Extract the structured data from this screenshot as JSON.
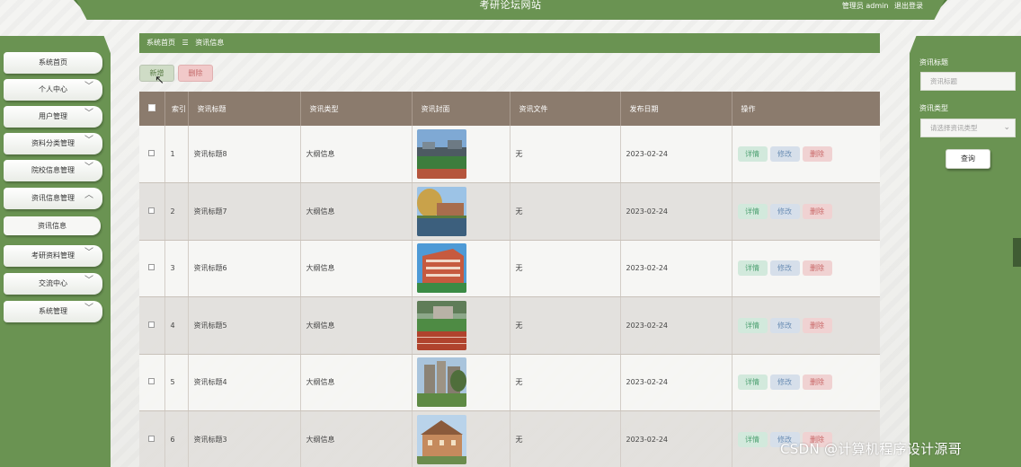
{
  "site": {
    "title": "考研论坛网站",
    "user_label": "管理员 admin",
    "logout_label": "退出登录"
  },
  "sidebar": {
    "items": [
      {
        "label": "系统首页",
        "chevron": ""
      },
      {
        "label": "个人中心",
        "chevron": "﹀"
      },
      {
        "label": "用户管理",
        "chevron": "﹀"
      },
      {
        "label": "资料分类管理",
        "chevron": "﹀"
      },
      {
        "label": "院校信息管理",
        "chevron": "﹀"
      },
      {
        "label": "资讯信息管理",
        "chevron": "︿"
      },
      {
        "label": "资讯信息",
        "chevron": ""
      },
      {
        "label": "考研资料管理",
        "chevron": "﹀"
      },
      {
        "label": "交流中心",
        "chevron": "﹀"
      },
      {
        "label": "系统管理",
        "chevron": "﹀"
      }
    ]
  },
  "breadcrumb": {
    "home": "系统首页",
    "sep": "☰",
    "current": "资讯信息"
  },
  "toolbar": {
    "add_label": "新增",
    "delete_label": "删除"
  },
  "table": {
    "headers": {
      "index": "索引",
      "title": "资讯标题",
      "type": "资讯类型",
      "cover": "资讯封面",
      "file": "资讯文件",
      "date": "发布日期",
      "ops": "操作"
    },
    "rows": [
      {
        "index": "1",
        "title": "资讯标题8",
        "type": "大纲信息",
        "file": "无",
        "date": "2023-02-24",
        "image": "stadium-photo"
      },
      {
        "index": "2",
        "title": "资讯标题7",
        "type": "大纲信息",
        "file": "无",
        "date": "2023-02-24",
        "image": "lake-campus-photo"
      },
      {
        "index": "3",
        "title": "资讯标题6",
        "type": "大纲信息",
        "file": "无",
        "date": "2023-02-24",
        "image": "red-building-photo"
      },
      {
        "index": "4",
        "title": "资讯标题5",
        "type": "大纲信息",
        "file": "无",
        "date": "2023-02-24",
        "image": "running-track-photo"
      },
      {
        "index": "5",
        "title": "资讯标题4",
        "type": "大纲信息",
        "file": "无",
        "date": "2023-02-24",
        "image": "tower-building-photo"
      },
      {
        "index": "6",
        "title": "资讯标题3",
        "type": "大纲信息",
        "file": "无",
        "date": "2023-02-24",
        "image": "brick-hall-photo"
      }
    ],
    "ops": {
      "detail": "详情",
      "edit": "修改",
      "delete": "删除"
    }
  },
  "search": {
    "title_label": "资讯标题",
    "title_placeholder": "资讯标题",
    "type_label": "资讯类型",
    "type_placeholder": "请选择资讯类型",
    "button_label": "查询"
  },
  "watermark": "CSDN @计算机程序设计源哥",
  "colors": {
    "primary_green": "#6a9352",
    "table_header": "#8b7b6d"
  }
}
